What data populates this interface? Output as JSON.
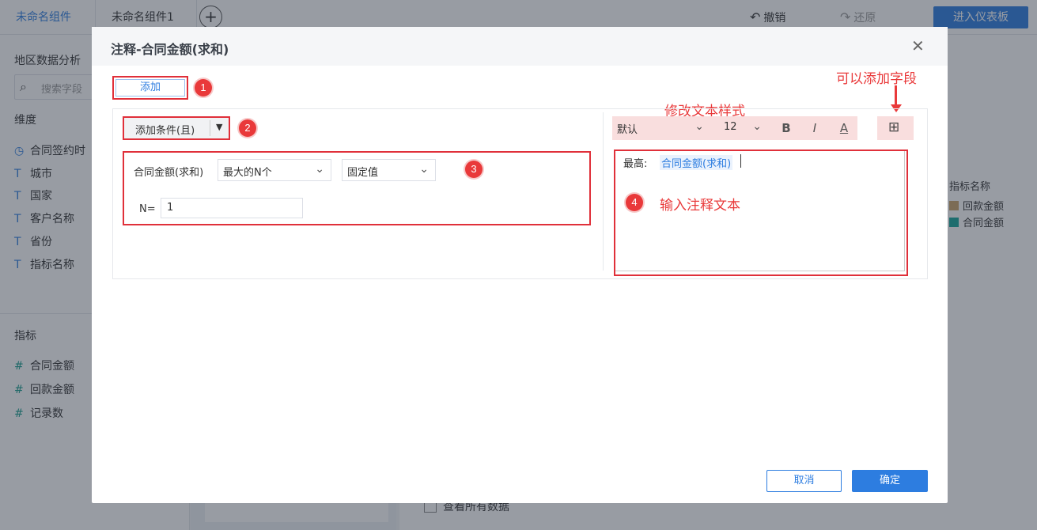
{
  "app": {
    "tabs": [
      {
        "label": "未命名组件",
        "active": true
      },
      {
        "label": "未命名组件1",
        "active": false
      }
    ],
    "toolbar": {
      "undo_label": "撤销",
      "redo_label": "还原",
      "enter_dashboard_label": "进入仪表板"
    }
  },
  "left_panel": {
    "title": "地区数据分析",
    "search_placeholder": "搜索字段",
    "dimension_header": "维度",
    "dimensions": [
      {
        "label": "合同签约时",
        "icon": "clock-icon"
      },
      {
        "label": "城市",
        "icon": "text-type-icon"
      },
      {
        "label": "国家",
        "icon": "text-type-icon"
      },
      {
        "label": "客户名称",
        "icon": "text-type-icon"
      },
      {
        "label": "省份",
        "icon": "text-type-icon"
      },
      {
        "label": "指标名称",
        "icon": "text-type-icon"
      }
    ],
    "metric_header": "指标",
    "metrics": [
      {
        "label": "合同金额",
        "icon": "number-type-icon"
      },
      {
        "label": "回款金额",
        "icon": "number-type-icon"
      },
      {
        "label": "记录数",
        "icon": "number-type-icon"
      }
    ]
  },
  "right_panel": {
    "legend_title": "指标名称",
    "legend_items": [
      {
        "label": "回款金额",
        "color": "#c9a46a"
      },
      {
        "label": "合同金额",
        "color": "#16a59a"
      }
    ],
    "view_all_data_label": "查看所有数据"
  },
  "dialog": {
    "title": "注释-合同金额(求和)",
    "add_label": "添加",
    "condition_type": "添加条件(且)",
    "condition": {
      "field": "合同金额(求和)",
      "operator": "最大的N个",
      "value_type": "固定值",
      "n_label": "N=",
      "n_value": "1"
    },
    "text_style": {
      "font": "默认",
      "size": "12",
      "bold_label": "B",
      "italic_label": "I",
      "underline_label": "A"
    },
    "editor": {
      "prefix": "最高:",
      "field_token": "合同金额(求和)"
    },
    "cancel_label": "取消",
    "ok_label": "确定"
  },
  "annotations": {
    "badges": [
      "1",
      "2",
      "3",
      "4"
    ],
    "modify_style": "修改文本样式",
    "add_field_hint": "可以添加字段",
    "input_text_hint": "输入注释文本"
  },
  "colors": {
    "accent": "#2d7de0",
    "annotation_red": "#e9393a",
    "metric_green": "#1a9e8f"
  }
}
